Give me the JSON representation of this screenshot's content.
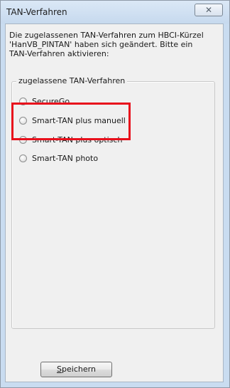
{
  "window": {
    "title": "TAN-Verfahren",
    "close_glyph": "✕"
  },
  "intro_text": "Die zugelassenen TAN-Verfahren zum HBCI-Kürzel\n'HanVB_PINTAN' haben sich geändert. Bitte ein\nTAN-Verfahren aktivieren:",
  "group": {
    "legend": "zugelassene TAN-Verfahren",
    "options": [
      {
        "label": "SecureGo",
        "selected": false
      },
      {
        "label": "Smart-TAN plus manuell",
        "selected": false
      },
      {
        "label": "Smart-TAN plus optisch",
        "selected": false
      },
      {
        "label": "Smart-TAN photo",
        "selected": false
      }
    ]
  },
  "save_button": {
    "mnemonic": "S",
    "rest": "peichern"
  },
  "colors": {
    "highlight": "#e8101c",
    "frame": "#c9dcf0",
    "client_bg": "#f0f0f0"
  }
}
